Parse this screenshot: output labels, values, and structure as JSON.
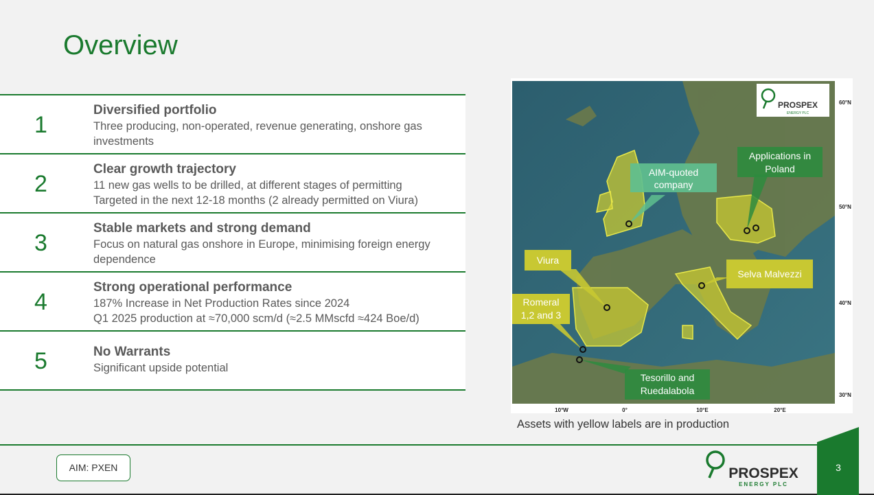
{
  "page": {
    "title": "Overview",
    "number": "3"
  },
  "items": [
    {
      "num": "1",
      "heading": "Diversified portfolio",
      "lines": [
        "Three producing, non-operated, revenue generating, onshore gas",
        "investments"
      ]
    },
    {
      "num": "2",
      "heading": "Clear growth trajectory",
      "lines": [
        "11 new gas wells to be drilled, at different stages of permitting",
        "Targeted in the next 12-18 months (2 already permitted on Viura)"
      ]
    },
    {
      "num": "3",
      "heading": "Stable markets and strong demand",
      "lines": [
        "Focus on natural gas onshore in Europe, minimising foreign energy",
        "dependence"
      ]
    },
    {
      "num": "4",
      "heading": "Strong operational performance",
      "lines": [
        "187% Increase in Net Production Rates since 2024",
        "Q1 2025 production at ≈70,000 scm/d (≈2.5 MMscfd ≈424 Boe/d)"
      ]
    },
    {
      "num": "5",
      "heading": "No Warrants",
      "lines": [
        "Significant upside potential",
        ""
      ]
    }
  ],
  "map": {
    "labels": {
      "aim": [
        "AIM-quoted",
        "company"
      ],
      "poland": [
        "Applications in",
        "Poland"
      ],
      "viura": "Viura",
      "selva": "Selva Malvezzi",
      "romeral": [
        "Romeral",
        "1,2 and 3"
      ],
      "tesorillo": [
        "Tesorillo and",
        "Ruedalabola"
      ]
    },
    "lat_ticks": [
      "60°N",
      "50°N",
      "40°N",
      "30°N"
    ],
    "lon_ticks": [
      "10°W",
      "0°",
      "10°E",
      "20°E"
    ],
    "caption": "Assets with yellow labels are in production",
    "colors": {
      "production": "#c8c832",
      "other": "#2e8b3e"
    }
  },
  "logo": {
    "name": "PROSPEX",
    "sub": "ENERGY PLC"
  },
  "footer": {
    "ticker": "AIM: PXEN"
  }
}
